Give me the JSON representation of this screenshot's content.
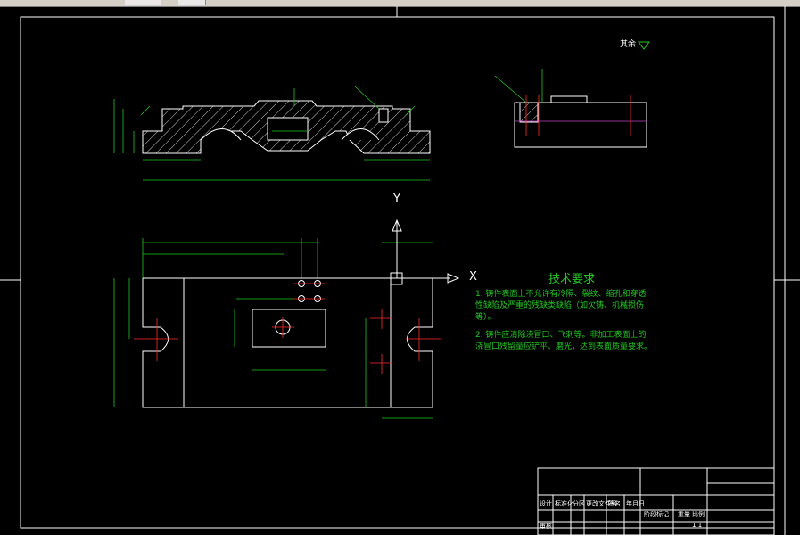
{
  "technical_requirements": {
    "title": "技术要求",
    "lines": [
      "1. 铸件表面上不允许有冷隔、裂纹、缩孔和穿透",
      "性缺陷及严重的残缺类缺陷（如欠铸、机械损伤",
      "等）。",
      "2. 铸件应清除浇冒口、飞刺等。非加工表面上的",
      "浇冒口残留量应铲平、磨光，达到表面质量要求。"
    ]
  },
  "surface_mark_rest": "其余",
  "axes": {
    "y": "Y",
    "x": "X"
  },
  "title_block": {
    "cells": [
      "设计",
      "标准化",
      "分区",
      "更改文件号",
      "签名",
      "年月日",
      "审核",
      "阶段标记",
      "重量",
      "比例"
    ],
    "scale": "1:1"
  },
  "colors": {
    "outline": "#ffffff",
    "dimension": "#22c522",
    "center": "#ff2a2a",
    "hatch": "#ffffff",
    "text": "#22c522"
  }
}
